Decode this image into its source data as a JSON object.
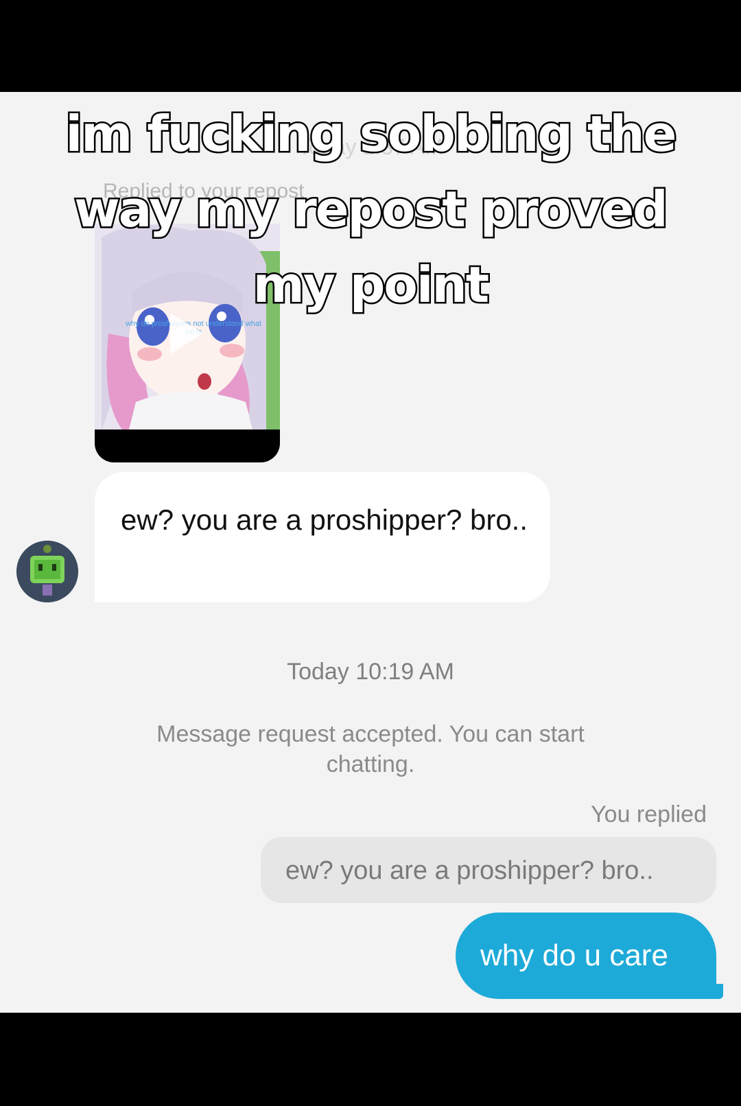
{
  "colors": {
    "background": "#f3f3f3",
    "incoming_bubble": "#ffffff",
    "outgoing_bubble": "#1eaad8",
    "quote_bubble": "#e6e6e6",
    "letterbox": "#000000"
  },
  "header_faded_time": "Today 1:37 AM",
  "replied_to_label": "Replied to your repost",
  "video_card": {
    "thumbnail_caption": "why do proshippers not understand what loli is",
    "icon": "play-icon"
  },
  "incoming_message": {
    "text": "ew? you are a proshipper? bro..",
    "avatar_icon": "avatar-robot"
  },
  "timestamp": "Today 10:19 AM",
  "system_message": "Message request accepted. You can start chatting.",
  "you_replied_label": "You replied",
  "quoted_message": "ew? you are a proshipper? bro..",
  "outgoing_message": "why do u care",
  "overlay_caption": {
    "line1": "im fucking sobbing the",
    "line2": "way my repost proved",
    "line3": "my point"
  }
}
